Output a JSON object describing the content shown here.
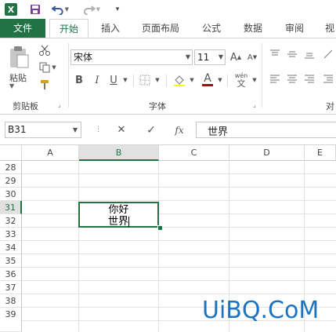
{
  "quick_access": {
    "app_icon": "excel-logo",
    "app_icon_letter": "X",
    "save_icon": "save-icon",
    "undo_icon": "undo-icon",
    "redo_icon": "redo-icon",
    "customize_icon": "customize-qat-icon"
  },
  "tabs": {
    "file": "文件",
    "items": [
      "开始",
      "插入",
      "页面布局",
      "公式",
      "数据",
      "审阅",
      "视"
    ],
    "active": "开始"
  },
  "ribbon": {
    "clipboard": {
      "paste_label": "粘贴",
      "group_label": "剪贴板"
    },
    "font": {
      "font_name": "宋体",
      "font_size": "11",
      "group_label": "字体",
      "bold": "B",
      "italic": "I",
      "underline": "U",
      "grow": "A",
      "shrink": "A",
      "font_color_letter": "A",
      "phonetic_top": "wén",
      "phonetic_bottom": "文",
      "font_color": "#c00000"
    },
    "alignment": {
      "group_label": "对"
    }
  },
  "formula_bar": {
    "name_box": "B31",
    "formula": "世界",
    "cancel": "✕",
    "enter": "✓",
    "fx": "fx"
  },
  "grid": {
    "columns": [
      "A",
      "B",
      "C",
      "D",
      "E"
    ],
    "selected_column": "B",
    "rows": [
      "28",
      "29",
      "30",
      "31",
      "32",
      "33",
      "34",
      "35",
      "36",
      "37",
      "38",
      "39"
    ],
    "selected_row": "31",
    "active_cell_lines": [
      "你好",
      "世界"
    ]
  },
  "watermark": "UiBQ.CoM",
  "colors": {
    "accent": "#217346",
    "watermark": "#1e73be"
  }
}
